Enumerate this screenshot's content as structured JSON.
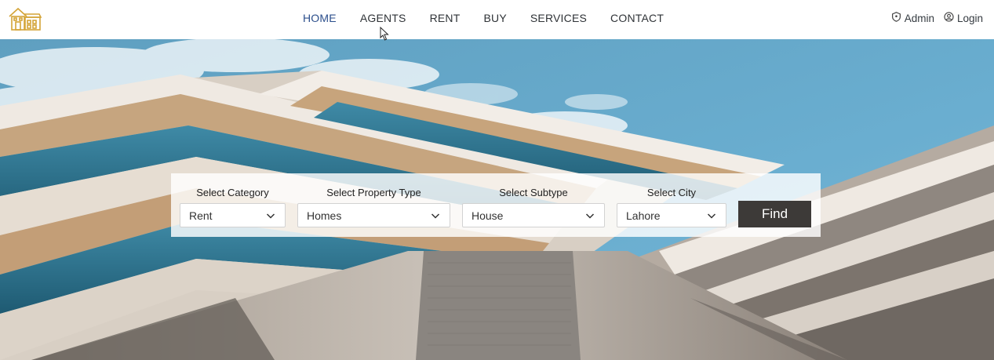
{
  "nav": {
    "links": [
      {
        "label": "HOME",
        "active": true
      },
      {
        "label": "AGENTS",
        "active": false
      },
      {
        "label": "RENT",
        "active": false
      },
      {
        "label": "BUY",
        "active": false
      },
      {
        "label": "SERVICES",
        "active": false
      },
      {
        "label": "CONTACT",
        "active": false
      }
    ],
    "admin_label": "Admin",
    "login_label": "Login"
  },
  "search": {
    "category": {
      "label": "Select Category",
      "value": "Rent"
    },
    "property_type": {
      "label": "Select Property Type",
      "value": "Homes"
    },
    "subtype": {
      "label": "Select Subtype",
      "value": "House"
    },
    "city": {
      "label": "Select City",
      "value": "Lahore"
    },
    "find_label": "Find"
  },
  "colors": {
    "logo": "#d4a437",
    "active_link": "#2c4f8c",
    "find_button": "#3d3a38"
  },
  "icons": {
    "logo": "house-logo-icon",
    "admin": "shield-icon",
    "login": "user-circle-icon",
    "dropdown": "chevron-down-icon"
  }
}
